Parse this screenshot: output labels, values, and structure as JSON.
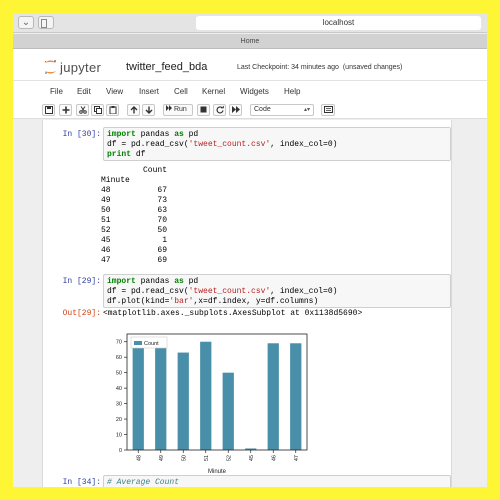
{
  "browser": {
    "address": "localhost",
    "tab_title": "Home"
  },
  "header": {
    "logo_text": "jupyter",
    "notebook_name": "twitter_feed_bda",
    "checkpoint": "Last Checkpoint: 34 minutes ago",
    "save_state": "(unsaved changes)"
  },
  "menu": [
    "File",
    "Edit",
    "View",
    "Insert",
    "Cell",
    "Kernel",
    "Widgets",
    "Help"
  ],
  "toolbar": {
    "run_label": "Run",
    "cell_type": "Code"
  },
  "cells": {
    "c1": {
      "prompt": "In [30]:",
      "lines": [
        "import pandas as pd",
        "df = pd.read_csv('tweet_count.csv', index_col=0)",
        "print df"
      ]
    },
    "c1_output": {
      "header": "Count",
      "index_name": "Minute",
      "rows": [
        {
          "minute": "48",
          "count": "67"
        },
        {
          "minute": "49",
          "count": "73"
        },
        {
          "minute": "50",
          "count": "63"
        },
        {
          "minute": "51",
          "count": "70"
        },
        {
          "minute": "52",
          "count": "50"
        },
        {
          "minute": "45",
          "count": "1"
        },
        {
          "minute": "46",
          "count": "69"
        },
        {
          "minute": "47",
          "count": "69"
        }
      ]
    },
    "c2": {
      "prompt": "In [29]:",
      "lines": [
        "import pandas as pd",
        "df = pd.read_csv('tweet_count.csv', index_col=0)",
        "df.plot(kind='bar',x=df.index, y=df.columns)"
      ]
    },
    "c2_output": {
      "prompt": "Out[29]:",
      "text": "<matplotlib.axes._subplots.AxesSubplot at 0x1138d5690>"
    },
    "c3": {
      "prompt": "In [34]:",
      "text": "# Average Count"
    }
  },
  "chart_data": {
    "type": "bar",
    "categories": [
      "48",
      "49",
      "50",
      "51",
      "52",
      "45",
      "46",
      "47"
    ],
    "series": [
      {
        "name": "Count",
        "values": [
          67,
          73,
          63,
          70,
          50,
          1,
          69,
          69
        ]
      }
    ],
    "xlabel": "Minute",
    "ylabel": "",
    "ylim": [
      0,
      75
    ],
    "yticks": [
      0,
      10,
      20,
      30,
      40,
      50,
      60,
      70
    ],
    "legend": "top-left",
    "grid": false,
    "bar_color": "#4a8faa"
  }
}
